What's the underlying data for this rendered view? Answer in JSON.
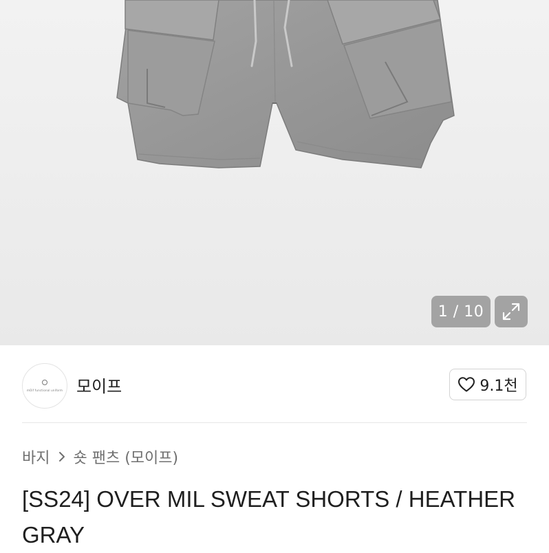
{
  "gallery": {
    "counter": "1 / 10",
    "image_alt": "Heather gray sweat cargo shorts",
    "colors": {
      "background": "#eeeeee",
      "garment": "#9a9a9a",
      "badge": "#a3a3a3"
    }
  },
  "shop": {
    "name": "모이프",
    "avatar_tagline": "mOif functional uniform",
    "likes": "9.1천"
  },
  "breadcrumb": {
    "category": "바지",
    "subcategory": "숏 팬츠 (모이프)"
  },
  "product": {
    "title": "[SS24] OVER MIL SWEAT SHORTS / HEATHER GRAY"
  },
  "icons": [
    "expand-icon",
    "heart-icon",
    "chevron-right-icon"
  ]
}
